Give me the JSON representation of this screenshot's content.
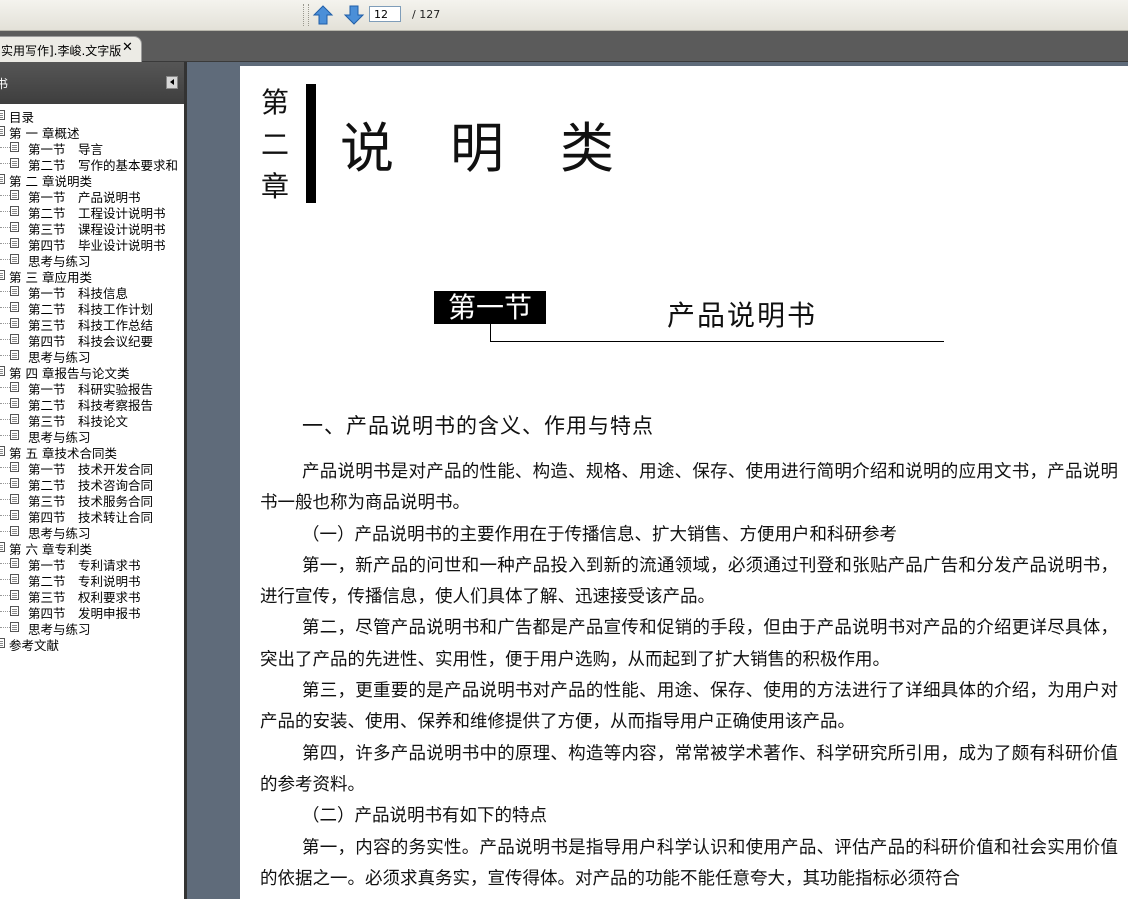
{
  "toolbar": {
    "prev_icon": "arrow-up-icon",
    "next_icon": "arrow-down-icon",
    "page_number": "12",
    "page_total": "/ 127"
  },
  "tab": {
    "title": "实用写作].李峻.文字版",
    "close": "✕"
  },
  "sidebar": {
    "header_label": "书"
  },
  "bookmarks": [
    {
      "level": 1,
      "label": "目录"
    },
    {
      "level": 1,
      "label": "第 一 章概述"
    },
    {
      "level": 2,
      "label": "第一节　导言"
    },
    {
      "level": 2,
      "label": "第二节　写作的基本要求和"
    },
    {
      "level": 1,
      "label": "第 二 章说明类"
    },
    {
      "level": 2,
      "label": "第一节　产品说明书"
    },
    {
      "level": 2,
      "label": "第二节　工程设计说明书"
    },
    {
      "level": 2,
      "label": "第三节　课程设计说明书"
    },
    {
      "level": 2,
      "label": "第四节　毕业设计说明书"
    },
    {
      "level": 2,
      "label": "思考与练习"
    },
    {
      "level": 1,
      "label": "第 三 章应用类"
    },
    {
      "level": 2,
      "label": "第一节　科技信息"
    },
    {
      "level": 2,
      "label": "第二节　科技工作计划"
    },
    {
      "level": 2,
      "label": "第三节　科技工作总结"
    },
    {
      "level": 2,
      "label": "第四节　科技会议纪要"
    },
    {
      "level": 2,
      "label": "思考与练习"
    },
    {
      "level": 1,
      "label": "第 四 章报告与论文类"
    },
    {
      "level": 2,
      "label": "第一节　科研实验报告"
    },
    {
      "level": 2,
      "label": "第二节　科技考察报告"
    },
    {
      "level": 2,
      "label": "第三节　科技论文"
    },
    {
      "level": 2,
      "label": "思考与练习"
    },
    {
      "level": 1,
      "label": "第 五 章技术合同类"
    },
    {
      "level": 2,
      "label": "第一节　技术开发合同"
    },
    {
      "level": 2,
      "label": "第二节　技术咨询合同"
    },
    {
      "level": 2,
      "label": "第三节　技术服务合同"
    },
    {
      "level": 2,
      "label": "第四节　技术转让合同"
    },
    {
      "level": 2,
      "label": "思考与练习"
    },
    {
      "level": 1,
      "label": "第 六 章专利类"
    },
    {
      "level": 2,
      "label": "第一节　专利请求书"
    },
    {
      "level": 2,
      "label": "第二节　专利说明书"
    },
    {
      "level": 2,
      "label": "第三节　权利要求书"
    },
    {
      "level": 2,
      "label": "第四节　发明申报书"
    },
    {
      "level": 2,
      "label": "思考与练习"
    },
    {
      "level": 1,
      "label": "参考文献"
    }
  ],
  "document": {
    "chapter_vertical": [
      "第",
      "二",
      "章"
    ],
    "chapter_title": "说明类",
    "section_label": "第一节",
    "section_title": "产品说明书",
    "heading": "一、产品说明书的含义、作用与特点",
    "paragraphs": [
      "产品说明书是对产品的性能、构造、规格、用途、保存、使用进行简明介绍和说明的应用文书，产品说明书一般也称为商品说明书。",
      "（一）产品说明书的主要作用在于传播信息、扩大销售、方便用户和科研参考",
      "第一，新产品的问世和一种产品投入到新的流通领域，必须通过刊登和张贴产品广告和分发产品说明书，进行宣传，传播信息，使人们具体了解、迅速接受该产品。",
      "第二，尽管产品说明书和广告都是产品宣传和促销的手段，但由于产品说明书对产品的介绍更详尽具体，突出了产品的先进性、实用性，便于用户选购，从而起到了扩大销售的积极作用。",
      "第三，更重要的是产品说明书对产品的性能、用途、保存、使用的方法进行了详细具体的介绍，为用户对产品的安装、使用、保养和维修提供了方便，从而指导用户正确使用该产品。",
      "第四，许多产品说明书中的原理、构造等内容，常常被学术著作、科学研究所引用，成为了颇有科研价值的参考资料。",
      "（二）产品说明书有如下的特点",
      "第一，内容的务实性。产品说明书是指导用户科学认识和使用产品、评估产品的科研价值和社会实用价值的依据之一。必须求真务实，宣传得体。对产品的功能不能任意夸大，其功能指标必须符合"
    ]
  }
}
